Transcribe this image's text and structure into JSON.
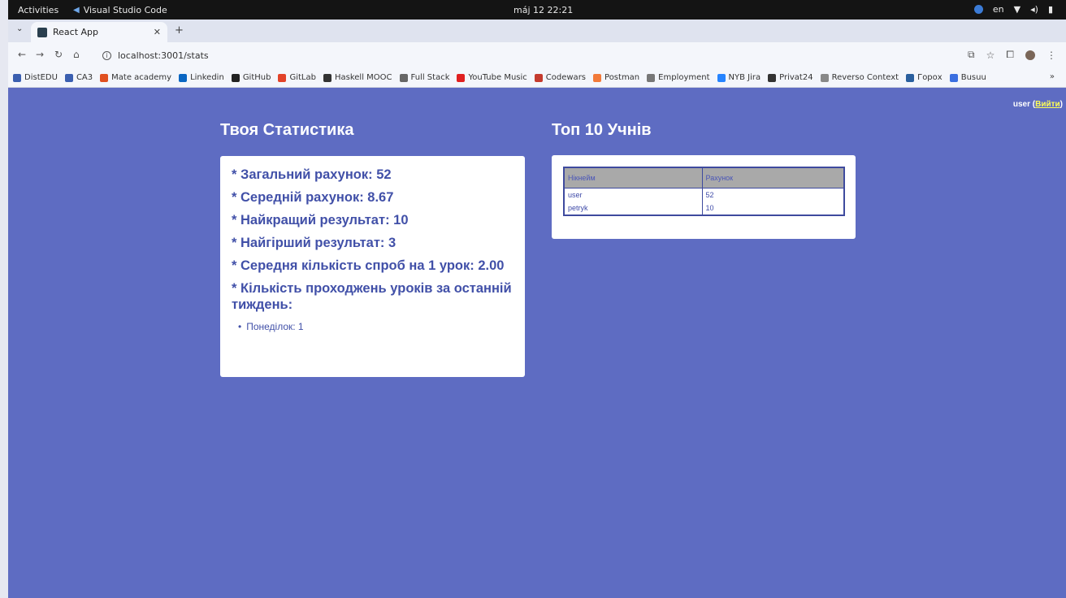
{
  "os": {
    "activities": "Activities",
    "app_name": "Visual Studio Code",
    "clock": "máj 12  22:21",
    "lang": "en"
  },
  "browser": {
    "tab_title": "React App",
    "url": "localhost:3001/stats",
    "bookmarks": [
      {
        "label": "DistEDU",
        "color": "#3b5fb0"
      },
      {
        "label": "CA3",
        "color": "#3b5fb0"
      },
      {
        "label": "Mate academy",
        "color": "#e05020"
      },
      {
        "label": "Linkedin",
        "color": "#0a66c2"
      },
      {
        "label": "GitHub",
        "color": "#222222"
      },
      {
        "label": "GitLab",
        "color": "#e24329"
      },
      {
        "label": "Haskell MOOC",
        "color": "#333333"
      },
      {
        "label": "Full Stack",
        "color": "#666666"
      },
      {
        "label": "YouTube Music",
        "color": "#e02020"
      },
      {
        "label": "Codewars",
        "color": "#c43b2e"
      },
      {
        "label": "Postman",
        "color": "#f27a3a"
      },
      {
        "label": "Employment",
        "color": "#777777"
      },
      {
        "label": "NYB Jira",
        "color": "#2684ff"
      },
      {
        "label": "Privat24",
        "color": "#333333"
      },
      {
        "label": "Reverso Context",
        "color": "#888888"
      },
      {
        "label": "Горох",
        "color": "#2a5f9e"
      },
      {
        "label": "Busuu",
        "color": "#3b6fe0"
      }
    ],
    "more": "»"
  },
  "page": {
    "user_name": "user",
    "logout_label": "Вийти",
    "stats_title": "Твоя Статистика",
    "top_title": "Топ 10 Учнів",
    "stats": [
      "* Загальний рахунок: 52",
      "* Середній рахунок: 8.67",
      "* Найкращий результат: 10",
      "* Найгірший результат: 3",
      "* Середня кількість спроб на 1 урок: 2.00",
      "* Кількість проходжень уроків за останній тиждень:"
    ],
    "week": [
      "Понеділок: 1"
    ],
    "table_headers": [
      "Нікнейм",
      "Рахунок"
    ],
    "rows": [
      {
        "name": "user",
        "score": "52"
      },
      {
        "name": "petryk",
        "score": "10"
      }
    ]
  },
  "colors": {
    "page_bg": "#5e6cc2",
    "card_text": "#4150a8",
    "logout_link": "#ffff55",
    "table_header_bg": "#a9a9a9"
  }
}
